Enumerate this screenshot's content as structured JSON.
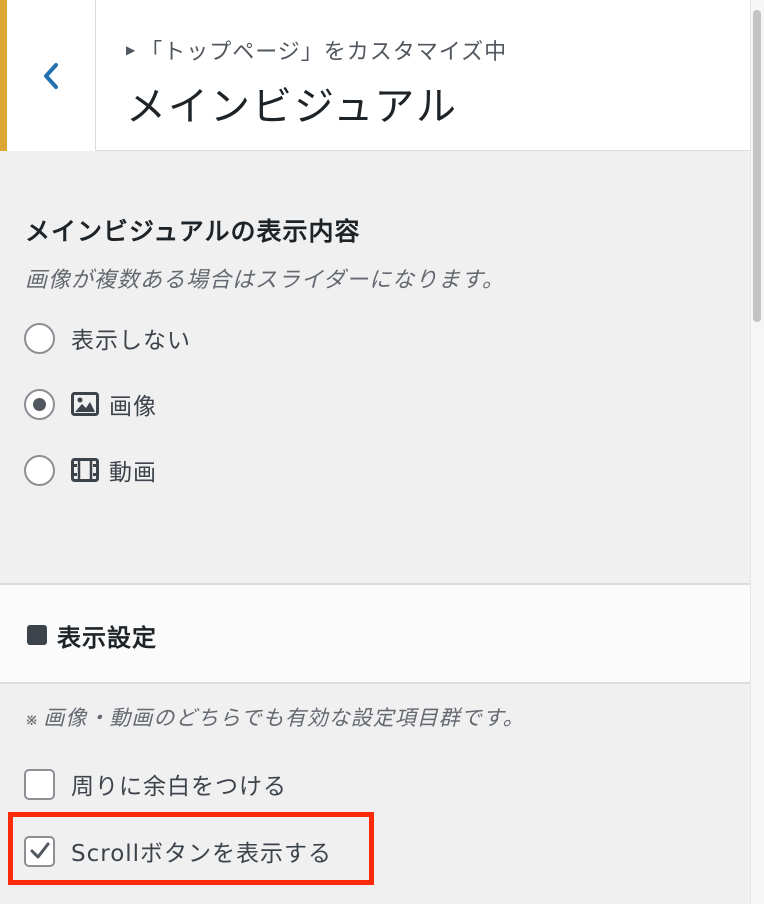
{
  "header": {
    "breadcrumb": "「トップページ」をカスタマイズ中",
    "title": "メインビジュアル",
    "accent_color": "#dba633",
    "back_icon": "chevron-left-icon"
  },
  "main_visual": {
    "title": "メインビジュアルの表示内容",
    "description": "画像が複数ある場合はスライダーになります。",
    "options": [
      {
        "label": "表示しない",
        "icon": "",
        "selected": false
      },
      {
        "label": "画像",
        "icon": "image-icon",
        "selected": true
      },
      {
        "label": "動画",
        "icon": "video-icon",
        "selected": false
      }
    ]
  },
  "display_settings": {
    "title": "表示設定",
    "note_mark": "※",
    "note": "画像・動画のどちらでも有効な設定項目群です。",
    "checkboxes": [
      {
        "label": "周りに余白をつける",
        "checked": false
      },
      {
        "label": "Scrollボタンを表示する",
        "checked": true
      }
    ],
    "highlight_color": "#fb2a09"
  }
}
